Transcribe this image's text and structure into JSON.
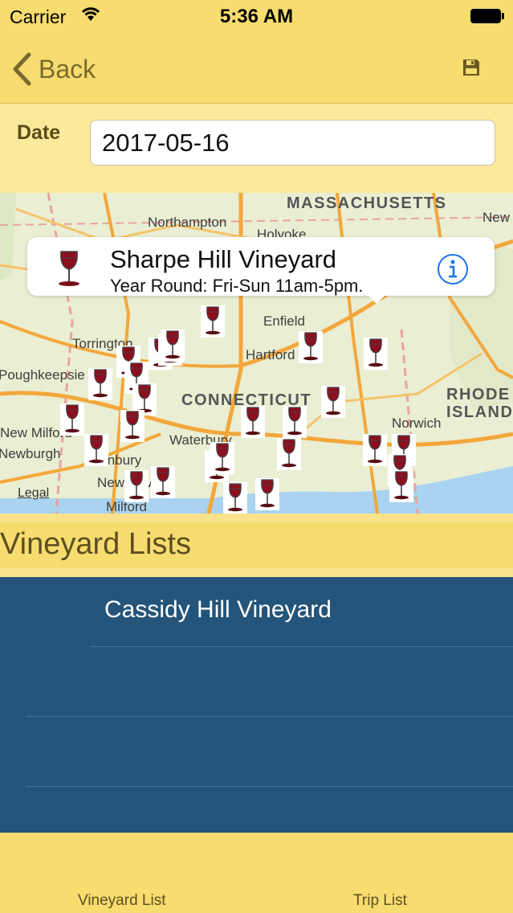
{
  "status_bar": {
    "carrier": "Carrier",
    "time": "5:36 AM"
  },
  "nav": {
    "back_label": "Back",
    "save_icon": "save-icon"
  },
  "date_field": {
    "label": "Date",
    "value": "2017-05-16"
  },
  "map": {
    "places": [
      "Northampton",
      "Holyoke",
      "Enfield",
      "Torrington",
      "Hartford",
      "Poughkeepsie",
      "New Milford",
      "Waterbury",
      "Newburgh",
      "Danbury",
      "New Haven",
      "Milford",
      "Norwich",
      "New",
      "Legal"
    ],
    "states": [
      "MASSACHUSETTS",
      "CONNECTICUT",
      "RHODE",
      "ISLAND"
    ],
    "callout": {
      "title": "Sharpe Hill Vineyard",
      "subtitle": "Year Round: Fri-Sun 11am-5pm."
    }
  },
  "section": {
    "title": "Vineyard Lists"
  },
  "list": {
    "items": [
      "Cassidy Hill Vineyard",
      "",
      ""
    ]
  },
  "tabs": {
    "left": "Vineyard List",
    "right": "Trip List"
  },
  "colors": {
    "bar_yellow": "#f7dc6f",
    "list_blue": "#245479",
    "wine_red": "#8b0f1f"
  }
}
